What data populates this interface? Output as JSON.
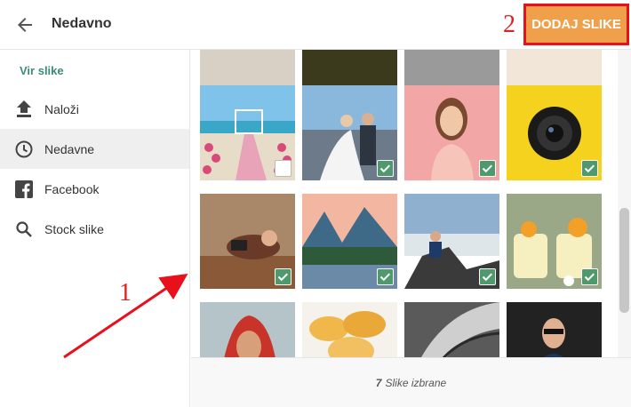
{
  "header": {
    "title": "Nedavno",
    "add_button": "DODAJ SLIKE",
    "back_icon": "arrow-left-icon"
  },
  "sidebar": {
    "heading": "Vir slike",
    "items": [
      {
        "label": "Naloži",
        "icon": "upload-icon",
        "active": false
      },
      {
        "label": "Nedavne",
        "icon": "clock-icon",
        "active": true
      },
      {
        "label": "Facebook",
        "icon": "facebook-icon",
        "active": false
      },
      {
        "label": "Stock slike",
        "icon": "search-icon",
        "active": false
      }
    ]
  },
  "gallery": {
    "tiles": [
      {
        "name": "partial-road-photo",
        "selected": false
      },
      {
        "name": "partial-field-photo",
        "selected": false
      },
      {
        "name": "partial-bw-photo",
        "selected": false
      },
      {
        "name": "partial-colorful-photo",
        "selected": false
      },
      {
        "name": "beach-wedding-photo",
        "selected": false
      },
      {
        "name": "wedding-couple-photo",
        "selected": true
      },
      {
        "name": "woman-portrait-photo",
        "selected": true
      },
      {
        "name": "camera-lens-photo",
        "selected": true
      },
      {
        "name": "photographer-autumn-photo",
        "selected": true
      },
      {
        "name": "mountain-lake-photo",
        "selected": true
      },
      {
        "name": "mountain-photographer-photo",
        "selected": true
      },
      {
        "name": "dessert-jars-photo",
        "selected": true
      },
      {
        "name": "bride-portrait-photo",
        "selected": false
      },
      {
        "name": "chips-photo",
        "selected": false
      },
      {
        "name": "architecture-photo",
        "selected": false
      },
      {
        "name": "man-suit-photo",
        "selected": false
      }
    ]
  },
  "footer": {
    "count": "7",
    "label": "Slike izbrane"
  },
  "annotations": {
    "step1": "1",
    "step2": "2"
  },
  "colors": {
    "accent": "#f0a04b",
    "highlight": "#e8101a",
    "check": "#4e9a6d",
    "heading": "#3c8a7a"
  }
}
